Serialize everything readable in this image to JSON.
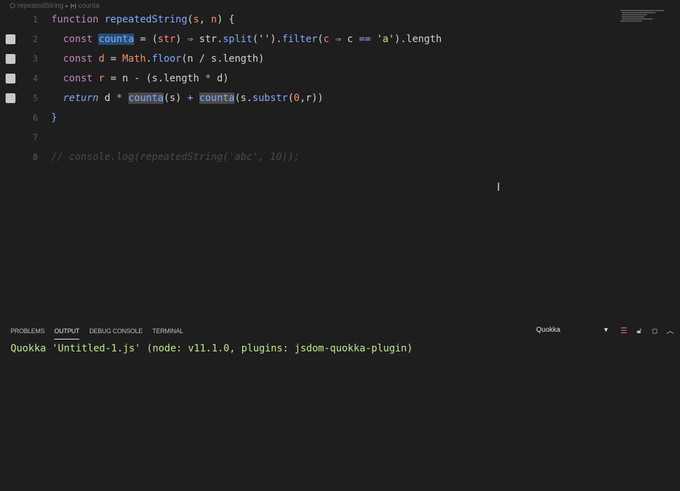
{
  "breadcrumb": {
    "file": "repeatedString",
    "symbol": "counta"
  },
  "editor": {
    "lines": [
      {
        "n": "1"
      },
      {
        "n": "2"
      },
      {
        "n": "3"
      },
      {
        "n": "4"
      },
      {
        "n": "5"
      },
      {
        "n": "6"
      },
      {
        "n": "7"
      },
      {
        "n": "8"
      }
    ],
    "tokens": {
      "l1": [
        "function",
        " ",
        "repeatedString",
        "(",
        "s",
        ", ",
        "n",
        ") {"
      ],
      "l2": [
        "  ",
        "const",
        " ",
        "counta",
        " = (",
        "str",
        ") ",
        "⇒",
        " str.",
        "split",
        "('').",
        "filter",
        "(",
        "c",
        " ",
        "⇒",
        " c ",
        "==",
        " ",
        "'a'",
        ").length"
      ],
      "l3": [
        "  ",
        "const",
        " ",
        "d",
        " = ",
        "Math",
        ".",
        "floor",
        "(n / s.length)"
      ],
      "l4": [
        "  ",
        "const",
        " ",
        "r",
        " = n - (s.length ",
        "*",
        " d)"
      ],
      "l5": [
        "  ",
        "return",
        " d ",
        "*",
        " ",
        "counta",
        "(s) ",
        "+",
        " ",
        "counta",
        "(s.",
        "substr",
        "(",
        "0",
        ",r))"
      ],
      "l6": [
        "}"
      ],
      "l8": [
        "// console.log(repeatedString('abc', 10));"
      ]
    }
  },
  "panel": {
    "tabs": [
      "Problems",
      "Output",
      "Debug Console",
      "Terminal"
    ],
    "active_tab": "Output",
    "selected_channel": "Quokka",
    "output_text": "Quokka 'Untitled-1.js' (node: v11.1.0, plugins: jsdom-quokka-plugin)"
  },
  "icons": {
    "clear-output": "list-icon",
    "lock-scroll": "lock-icon",
    "maximize": "maximize-icon",
    "collapse": "chevron-up-icon"
  }
}
